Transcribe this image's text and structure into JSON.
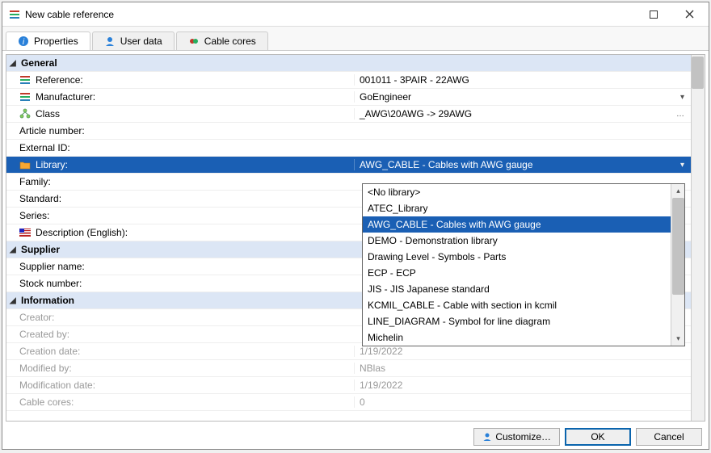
{
  "window": {
    "title": "New cable reference"
  },
  "tabs": [
    {
      "label": "Properties",
      "active": true,
      "icon": "info-icon"
    },
    {
      "label": "User data",
      "active": false,
      "icon": "user-icon"
    },
    {
      "label": "Cable cores",
      "active": false,
      "icon": "cores-icon"
    }
  ],
  "groups": {
    "general": "General",
    "supplier": "Supplier",
    "information": "Information"
  },
  "fields": {
    "reference": {
      "label": "Reference:",
      "value": "001011 - 3PAIR - 22AWG"
    },
    "manufacturer": {
      "label": "Manufacturer:",
      "value": "GoEngineer"
    },
    "class": {
      "label": "Class",
      "value": "_AWG\\20AWG -> 29AWG"
    },
    "article": {
      "label": "Article number:",
      "value": ""
    },
    "external": {
      "label": "External ID:",
      "value": ""
    },
    "library": {
      "label": "Library:",
      "value": "AWG_CABLE - Cables with AWG gauge"
    },
    "family": {
      "label": "Family:",
      "value": ""
    },
    "standard": {
      "label": "Standard:",
      "value": ""
    },
    "series": {
      "label": "Series:",
      "value": ""
    },
    "description": {
      "label": "Description (English):",
      "value": ""
    },
    "supplier_name": {
      "label": "Supplier name:",
      "value": ""
    },
    "stock_number": {
      "label": "Stock number:",
      "value": ""
    },
    "creator": {
      "label": "Creator:",
      "value": ""
    },
    "created_by": {
      "label": "Created by:",
      "value": ""
    },
    "creation_date": {
      "label": "Creation date:",
      "value": "1/19/2022"
    },
    "modified_by": {
      "label": "Modified by:",
      "value": "NBlas"
    },
    "modification_date": {
      "label": "Modification date:",
      "value": "1/19/2022"
    },
    "cable_cores": {
      "label": "Cable cores:",
      "value": "0"
    }
  },
  "dropdown": {
    "items": [
      "<No library>",
      "ATEC_Library",
      "AWG_CABLE - Cables with AWG gauge",
      "DEMO - Demonstration library",
      "Drawing Level - Symbols - Parts",
      "ECP - ECP",
      "JIS - JIS Japanese standard",
      "KCMIL_CABLE - Cable with section in kcmil",
      "LINE_DIAGRAM - Symbol for line diagram",
      "Michelin"
    ],
    "selected_index": 2
  },
  "footer": {
    "customize": "Customize…",
    "ok": "OK",
    "cancel": "Cancel"
  },
  "glyphs": {
    "caret_down": "▾",
    "caret_up": "▴",
    "caret_right_group": "◢",
    "ellipsis": "…"
  }
}
